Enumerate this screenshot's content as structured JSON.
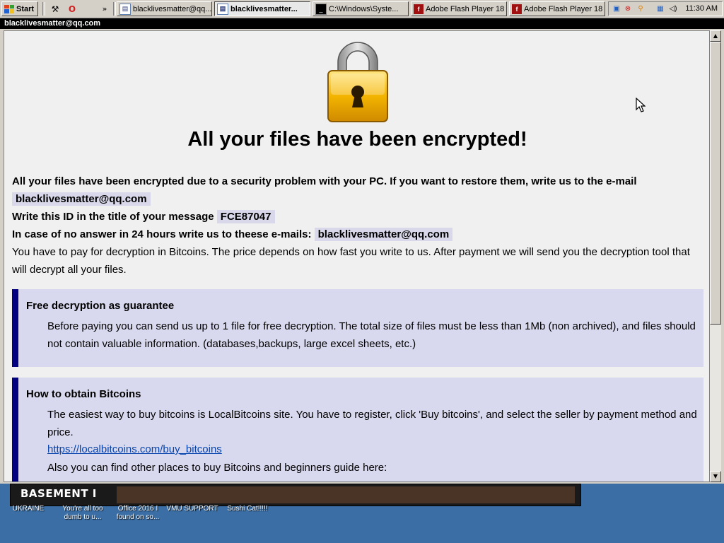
{
  "taskbar": {
    "start_label": "Start",
    "quicklaunch_more": "»",
    "tasks": [
      {
        "label": "blacklivesmatter@qq...",
        "icon": "document-icon"
      },
      {
        "label": "blacklivesmatter...",
        "icon": "document-icon"
      },
      {
        "label": "C:\\Windows\\Syste...",
        "icon": "console-icon"
      },
      {
        "label": "Adobe Flash Player 18",
        "icon": "flash-icon"
      },
      {
        "label": "Adobe Flash Player 18",
        "icon": "flash-icon"
      }
    ],
    "clock": "11:30 AM"
  },
  "desktop": {
    "window_title": "BASEMENT I",
    "icons": [
      {
        "label": "UKRAINE"
      },
      {
        "label": "You're all too\ndumb to u..."
      },
      {
        "label": "Office 2016 I\nfound on so..."
      },
      {
        "label": "VMU SUPPORT"
      },
      {
        "label": "Sushi Cat!!!!!"
      }
    ]
  },
  "window": {
    "title": "blacklivesmatter@qq.com"
  },
  "ransom": {
    "headline": "All your files have been encrypted!",
    "line1": "All your files have been encrypted due to a security problem with your PC. If you want to restore them, write us to the e-mail",
    "email": "blacklivesmatter@qq.com",
    "id_label": "Write this ID in the title of your message",
    "id_value": "FCE87047",
    "no_answer_label": "In case of no answer in 24 hours write us to theese e-mails:",
    "email2": "blacklivesmatter@qq.com",
    "pay_line1": "You have to pay for decryption in Bitcoins. The price depends on how fast you write to us. After payment we will send you the decryption tool that",
    "pay_line2": "will decrypt all your files.",
    "box1": {
      "title": "Free decryption as guarantee",
      "text": "Before paying you can send us up to 1 file for free decryption. The total size of files must be less than 1Mb (non archived), and files should not contain valuable information. (databases,backups, large excel sheets, etc.)"
    },
    "box2": {
      "title": "How to obtain Bitcoins",
      "text": "The easiest way to buy bitcoins is LocalBitcoins site. You have to register, click 'Buy bitcoins', and select the seller by payment method and price.",
      "link": "https://localbitcoins.com/buy_bitcoins",
      "text2": "Also you can find other places to buy Bitcoins and beginners guide here:"
    }
  },
  "colors": {
    "accent_bar": "#000080",
    "box_background": "#d8d8ee",
    "lock_gold": "#f4b400"
  }
}
